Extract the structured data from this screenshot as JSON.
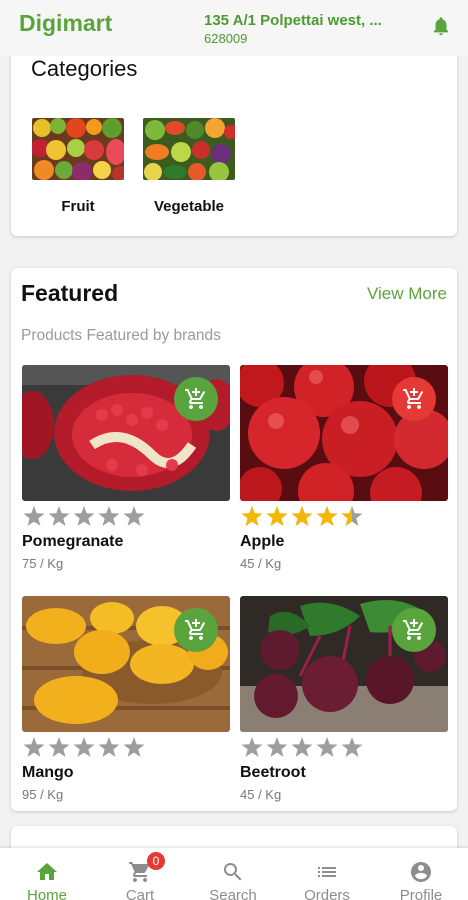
{
  "header": {
    "brand": "Digimart",
    "address_line1": "135 A/1 Polpettai west, ...",
    "address_line2": "628009",
    "notification_icon": "bell-icon"
  },
  "categories": {
    "title": "Categories",
    "items": [
      {
        "label": "Fruit"
      },
      {
        "label": "Vegetable"
      }
    ]
  },
  "featured": {
    "title": "Featured",
    "view_more": "View More",
    "subtitle": "Products Featured by brands",
    "products": [
      {
        "name": "Pomegranate",
        "price": "75 / Kg",
        "rating": 0,
        "cart_color": "#5aa43d"
      },
      {
        "name": "Apple",
        "price": "45 / Kg",
        "rating": 4.5,
        "cart_color": "#e53935"
      },
      {
        "name": "Mango",
        "price": "95 / Kg",
        "rating": 0,
        "cart_color": "#5aa43d"
      },
      {
        "name": "Beetroot",
        "price": "45 / Kg",
        "rating": 0,
        "cart_color": "#5aa43d"
      }
    ]
  },
  "bottom_nav": {
    "items": [
      {
        "label": "Home",
        "icon": "home-icon",
        "active": true
      },
      {
        "label": "Cart",
        "icon": "cart-icon",
        "badge": "0"
      },
      {
        "label": "Search",
        "icon": "search-icon"
      },
      {
        "label": "Orders",
        "icon": "list-icon"
      },
      {
        "label": "Profile",
        "icon": "profile-icon"
      }
    ]
  },
  "colors": {
    "accent": "#5aa43d",
    "star_filled": "#f5b800",
    "star_empty": "#9e9e9e",
    "badge": "#e53935"
  }
}
